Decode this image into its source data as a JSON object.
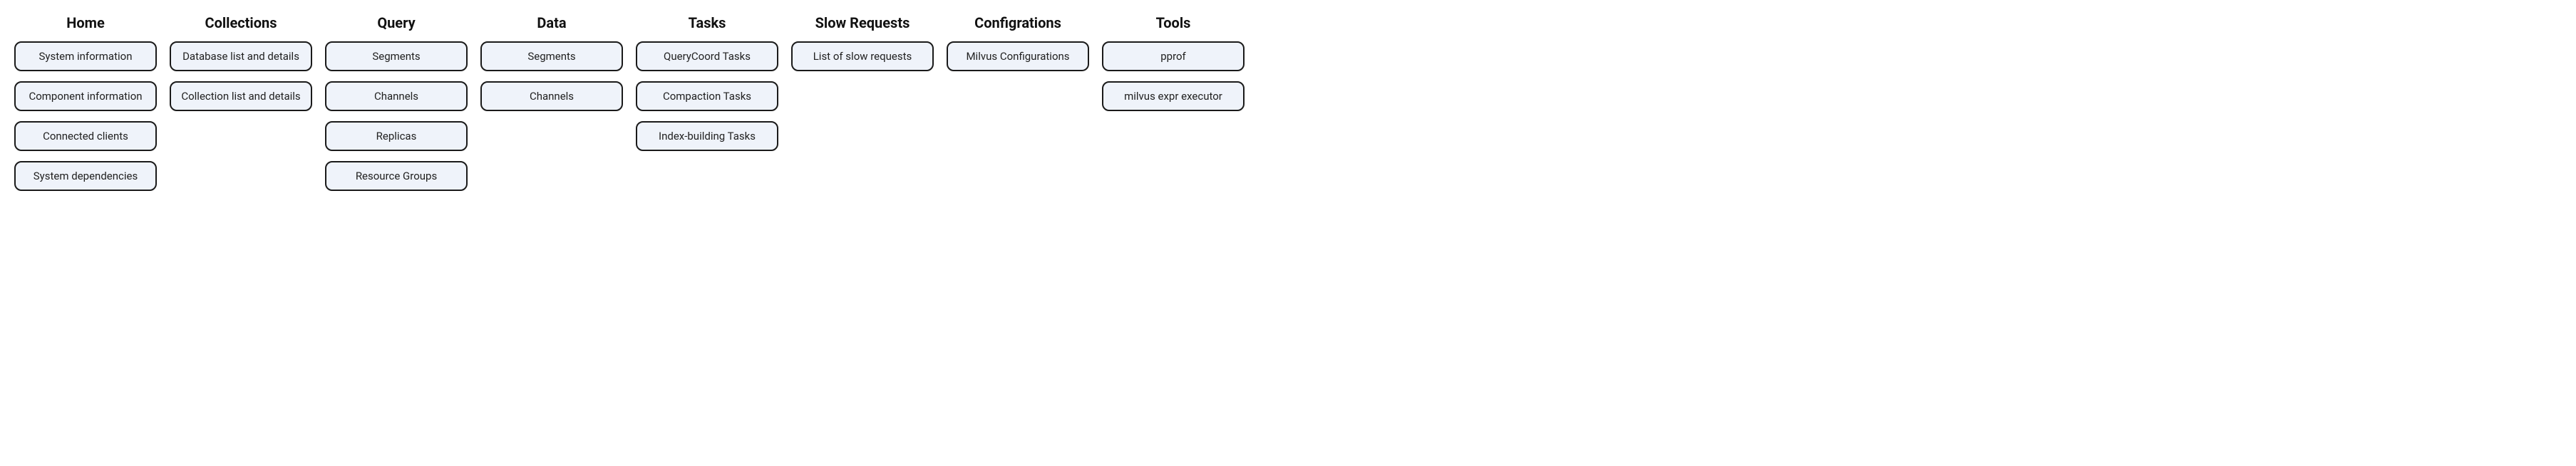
{
  "columns": [
    {
      "header": "Home",
      "name": "home",
      "items": [
        {
          "label": "System information",
          "name": "system-information"
        },
        {
          "label": "Component information",
          "name": "component-information"
        },
        {
          "label": "Connected clients",
          "name": "connected-clients"
        },
        {
          "label": "System dependencies",
          "name": "system-dependencies"
        }
      ]
    },
    {
      "header": "Collections",
      "name": "collections",
      "items": [
        {
          "label": "Database list and details",
          "name": "database-list-and-details"
        },
        {
          "label": "Collection list and details",
          "name": "collection-list-and-details"
        }
      ]
    },
    {
      "header": "Query",
      "name": "query",
      "items": [
        {
          "label": "Segments",
          "name": "query-segments"
        },
        {
          "label": "Channels",
          "name": "query-channels"
        },
        {
          "label": "Replicas",
          "name": "replicas"
        },
        {
          "label": "Resource Groups",
          "name": "resource-groups"
        }
      ]
    },
    {
      "header": "Data",
      "name": "data",
      "items": [
        {
          "label": "Segments",
          "name": "data-segments"
        },
        {
          "label": "Channels",
          "name": "data-channels"
        }
      ]
    },
    {
      "header": "Tasks",
      "name": "tasks",
      "items": [
        {
          "label": "QueryCoord Tasks",
          "name": "querycoord-tasks"
        },
        {
          "label": "Compaction Tasks",
          "name": "compaction-tasks"
        },
        {
          "label": "Index-building Tasks",
          "name": "index-building-tasks"
        }
      ]
    },
    {
      "header": "Slow Requests",
      "name": "slow-requests",
      "items": [
        {
          "label": "List of slow requests",
          "name": "list-of-slow-requests"
        }
      ]
    },
    {
      "header": "Configrations",
      "name": "configrations",
      "items": [
        {
          "label": "Milvus Configurations",
          "name": "milvus-configurations"
        }
      ]
    },
    {
      "header": "Tools",
      "name": "tools",
      "items": [
        {
          "label": "pprof",
          "name": "pprof"
        },
        {
          "label": "milvus expr executor",
          "name": "milvus-expr-executor"
        }
      ]
    }
  ]
}
